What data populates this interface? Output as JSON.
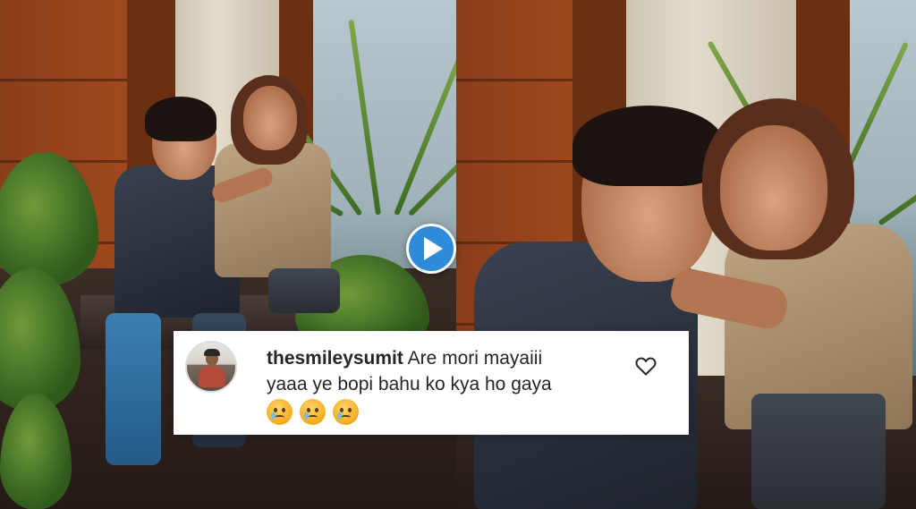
{
  "video": {
    "play_icon": "play-icon"
  },
  "comment": {
    "username": "thesmileysumit",
    "text_line1": "Are mori mayaiii",
    "text_line2": "yaaa ye bopi bahu ko kya ho gaya",
    "emojis": [
      "crying-face-icon",
      "crying-face-icon",
      "crying-face-icon"
    ],
    "like_icon": "heart-outline-icon",
    "avatar_icon": "profile-avatar"
  },
  "colors": {
    "play_button": "#2f8ad8",
    "card_background": "#ffffff",
    "text": "#262626"
  }
}
